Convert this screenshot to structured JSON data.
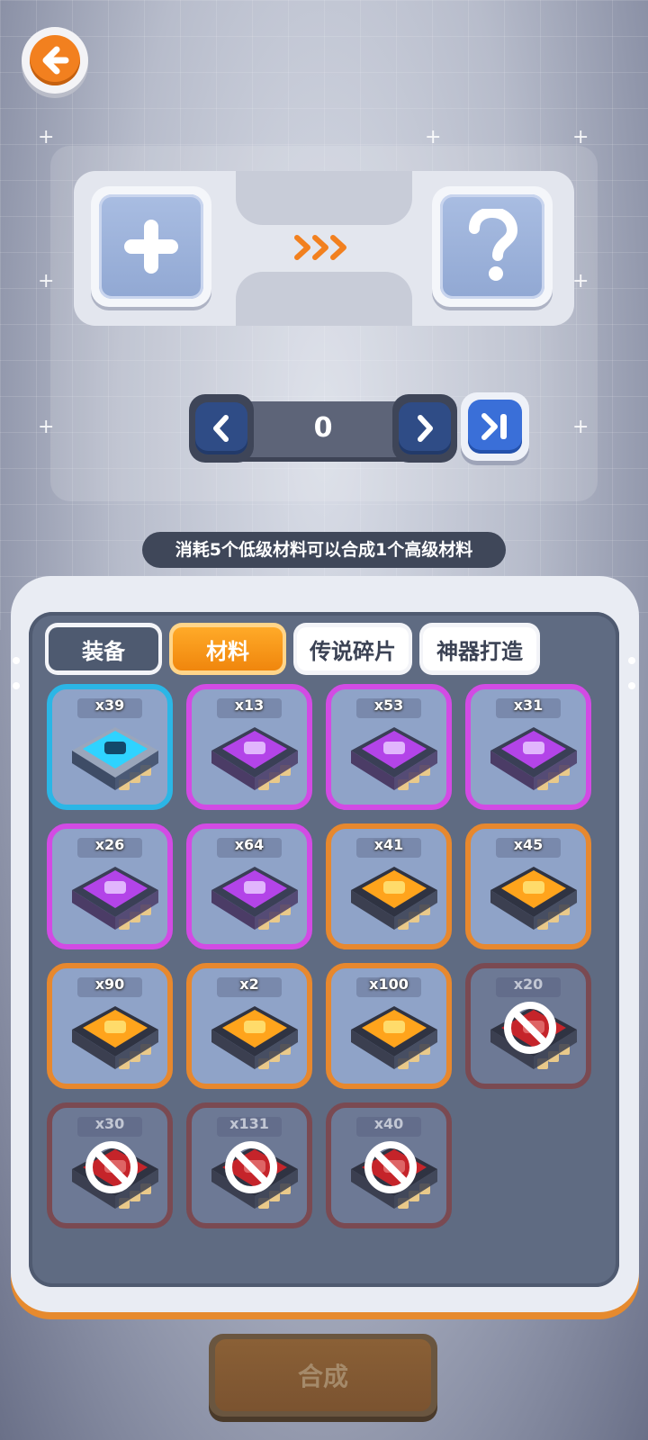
{
  "header": {
    "back_icon": "arrow-left-icon"
  },
  "craft": {
    "input_slot_icon": "plus-icon",
    "output_slot_icon": "question-mark-icon",
    "arrow_icon": "triple-chevron-right-icon",
    "quantity": "0",
    "hint": "消耗5个低级材料可以合成1个高级材料"
  },
  "tabs": [
    {
      "label": "装备",
      "active": false
    },
    {
      "label": "材料",
      "active": true
    },
    {
      "label": "传说碎片",
      "active": false
    },
    {
      "label": "神器打造",
      "active": false
    }
  ],
  "items": [
    {
      "count": "x39",
      "rarity": "blue",
      "locked": false
    },
    {
      "count": "x13",
      "rarity": "purple",
      "locked": false
    },
    {
      "count": "x53",
      "rarity": "purple",
      "locked": false
    },
    {
      "count": "x31",
      "rarity": "purple",
      "locked": false
    },
    {
      "count": "x26",
      "rarity": "purple",
      "locked": false
    },
    {
      "count": "x64",
      "rarity": "purple",
      "locked": false
    },
    {
      "count": "x41",
      "rarity": "orange",
      "locked": false
    },
    {
      "count": "x45",
      "rarity": "orange",
      "locked": false
    },
    {
      "count": "x90",
      "rarity": "orange",
      "locked": false
    },
    {
      "count": "x2",
      "rarity": "orange",
      "locked": false
    },
    {
      "count": "x100",
      "rarity": "orange",
      "locked": false
    },
    {
      "count": "x20",
      "rarity": "red",
      "locked": true
    },
    {
      "count": "x30",
      "rarity": "red",
      "locked": true
    },
    {
      "count": "x131",
      "rarity": "red",
      "locked": true
    },
    {
      "count": "x40",
      "rarity": "red",
      "locked": true
    }
  ],
  "actions": {
    "compose_label": "合成"
  },
  "colors": {
    "accent_orange": "#f2801f",
    "rarity_blue": "#2bb6e6",
    "rarity_purple": "#d24be4",
    "rarity_orange": "#e7882e",
    "rarity_red": "#7a4a52"
  }
}
